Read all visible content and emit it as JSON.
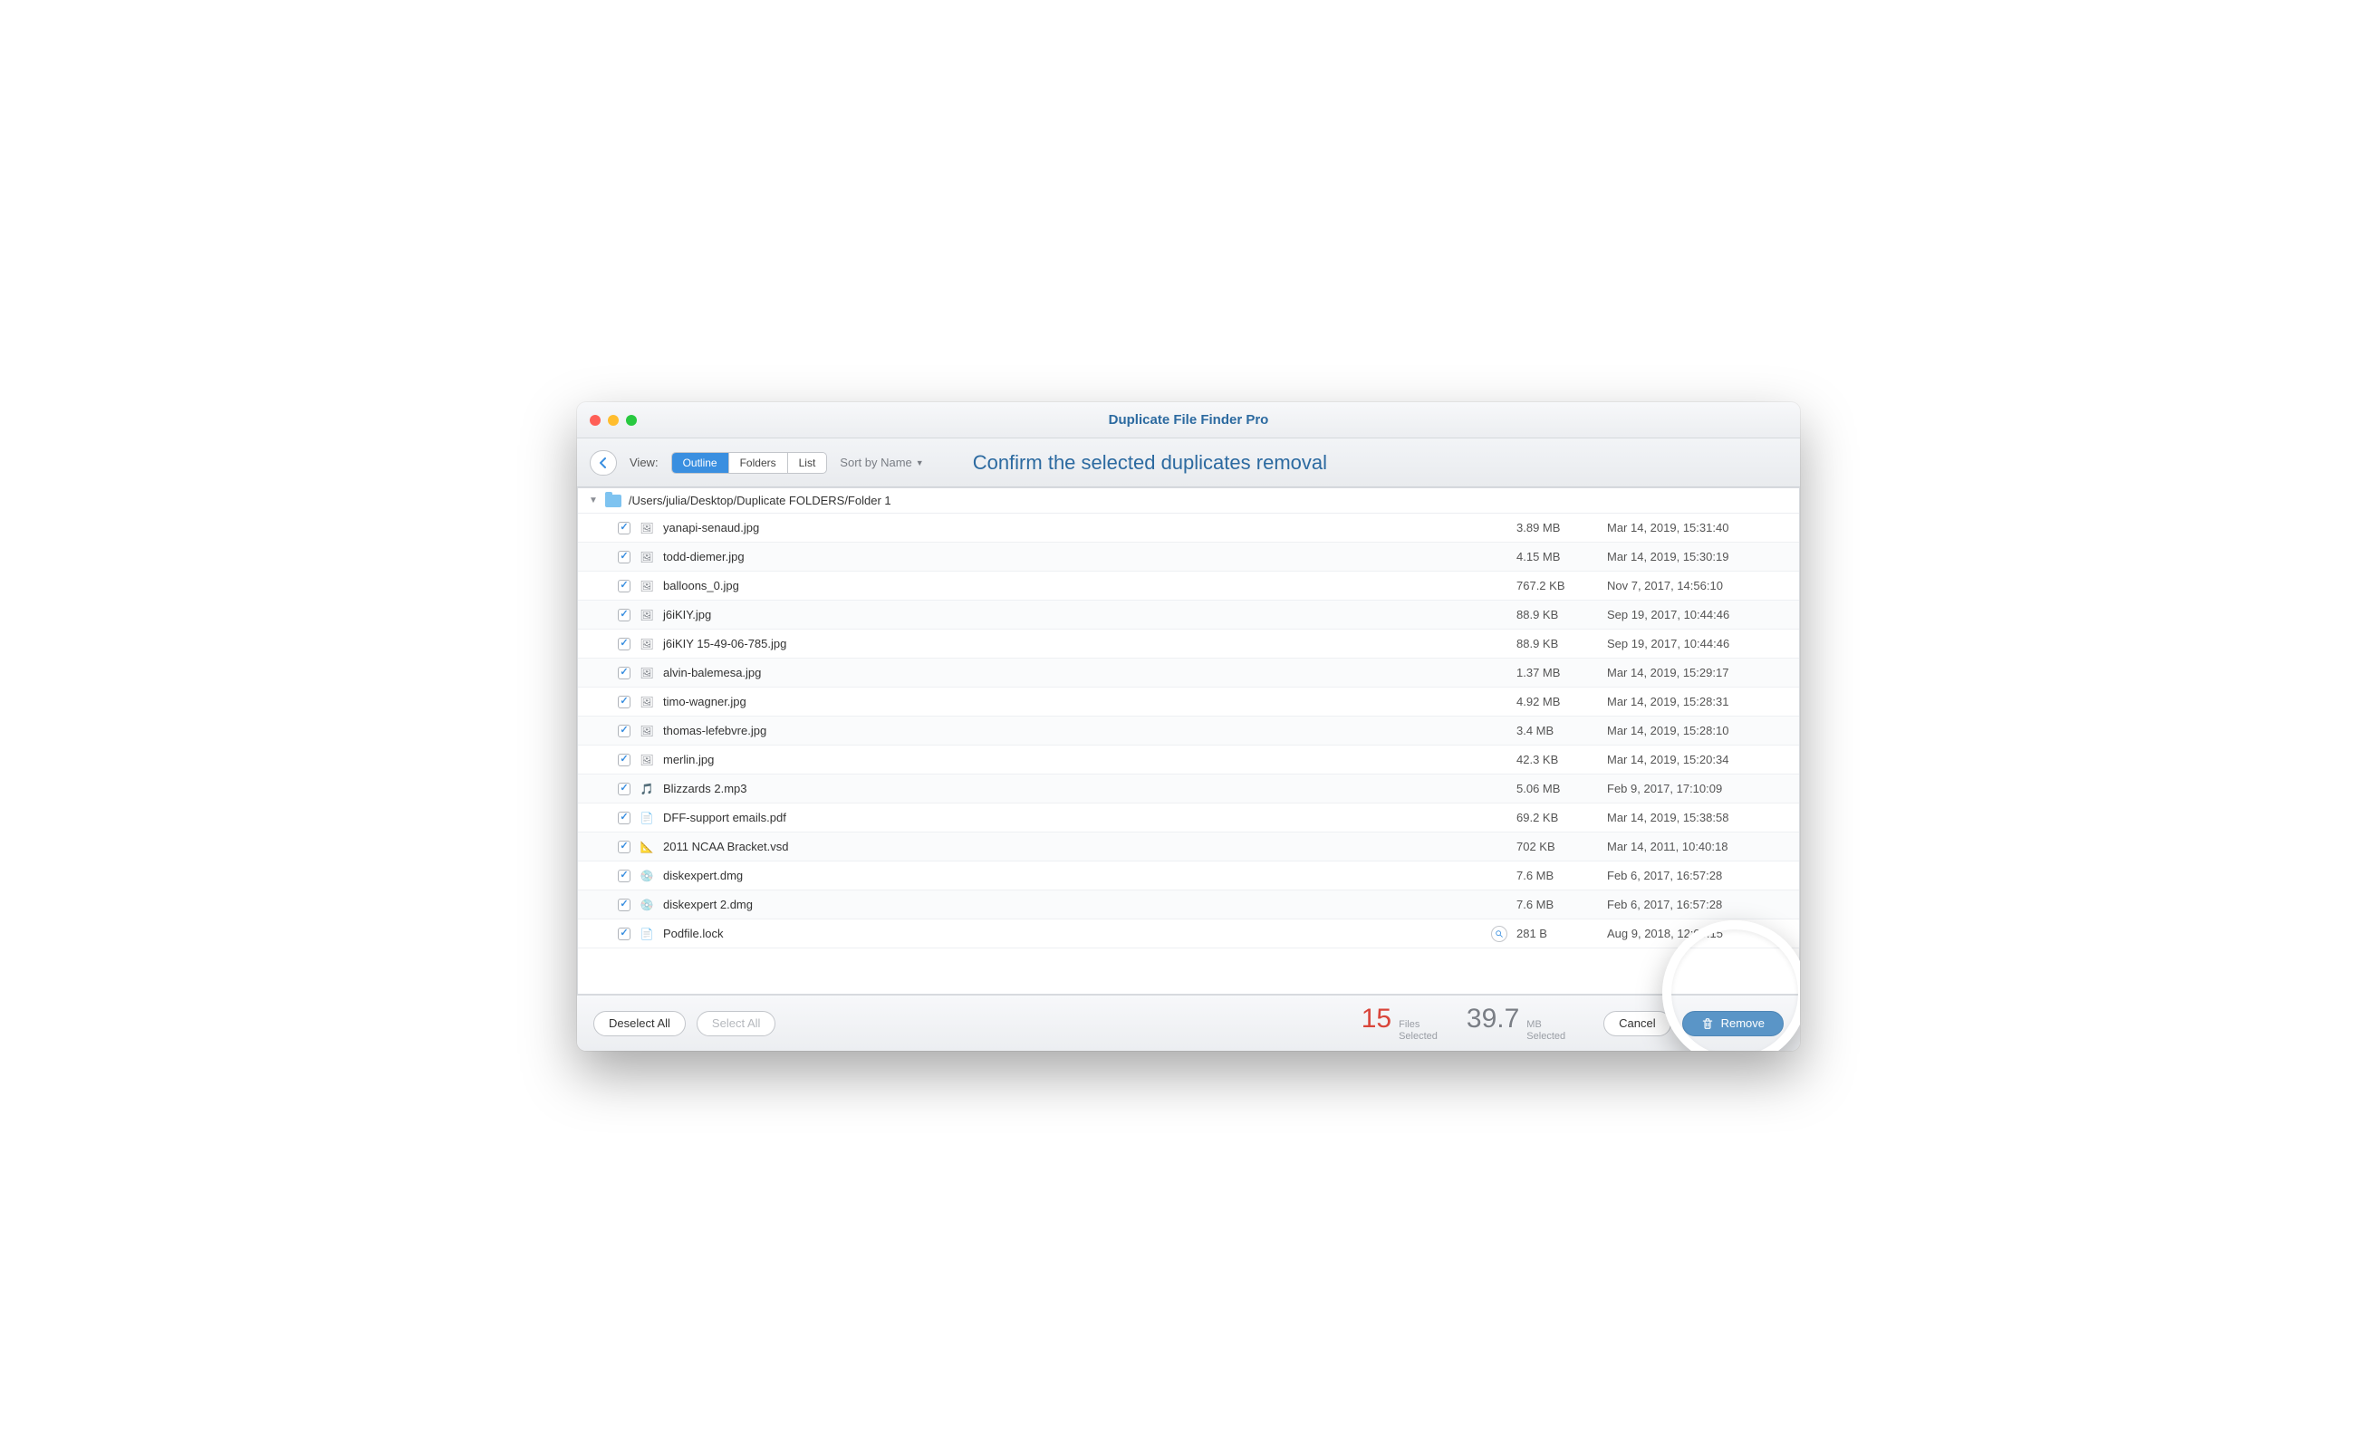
{
  "window": {
    "title": "Duplicate File Finder Pro"
  },
  "toolbar": {
    "view_label": "View:",
    "segments": {
      "outline": "Outline",
      "folders": "Folders",
      "list": "List"
    },
    "active_segment": "outline",
    "sort_label": "Sort by Name",
    "subtitle": "Confirm the selected duplicates removal"
  },
  "group": {
    "path": "/Users/julia/Desktop/Duplicate FOLDERS/Folder 1"
  },
  "files": [
    {
      "name": "yanapi-senaud.jpg",
      "size": "3.89 MB",
      "date": "Mar 14, 2019, 15:31:40",
      "icon": "image",
      "checked": true
    },
    {
      "name": "todd-diemer.jpg",
      "size": "4.15 MB",
      "date": "Mar 14, 2019, 15:30:19",
      "icon": "image",
      "checked": true
    },
    {
      "name": "balloons_0.jpg",
      "size": "767.2 KB",
      "date": "Nov 7, 2017, 14:56:10",
      "icon": "image",
      "checked": true
    },
    {
      "name": "j6iKIY.jpg",
      "size": "88.9 KB",
      "date": "Sep 19, 2017, 10:44:46",
      "icon": "image",
      "checked": true
    },
    {
      "name": "j6iKIY 15-49-06-785.jpg",
      "size": "88.9 KB",
      "date": "Sep 19, 2017, 10:44:46",
      "icon": "image",
      "checked": true
    },
    {
      "name": "alvin-balemesa.jpg",
      "size": "1.37 MB",
      "date": "Mar 14, 2019, 15:29:17",
      "icon": "image",
      "checked": true
    },
    {
      "name": "timo-wagner.jpg",
      "size": "4.92 MB",
      "date": "Mar 14, 2019, 15:28:31",
      "icon": "image",
      "checked": true
    },
    {
      "name": "thomas-lefebvre.jpg",
      "size": "3.4 MB",
      "date": "Mar 14, 2019, 15:28:10",
      "icon": "image",
      "checked": true
    },
    {
      "name": "merlin.jpg",
      "size": "42.3 KB",
      "date": "Mar 14, 2019, 15:20:34",
      "icon": "image",
      "checked": true
    },
    {
      "name": "Blizzards 2.mp3",
      "size": "5.06 MB",
      "date": "Feb 9, 2017, 17:10:09",
      "icon": "audio",
      "checked": true
    },
    {
      "name": "DFF-support emails.pdf",
      "size": "69.2 KB",
      "date": "Mar 14, 2019, 15:38:58",
      "icon": "doc",
      "checked": true
    },
    {
      "name": "2011 NCAA Bracket.vsd",
      "size": "702 KB",
      "date": "Mar 14, 2011, 10:40:18",
      "icon": "vsd",
      "checked": true
    },
    {
      "name": "diskexpert.dmg",
      "size": "7.6 MB",
      "date": "Feb 6, 2017, 16:57:28",
      "icon": "dmg",
      "checked": true
    },
    {
      "name": "diskexpert 2.dmg",
      "size": "7.6 MB",
      "date": "Feb 6, 2017, 16:57:28",
      "icon": "dmg",
      "checked": true
    },
    {
      "name": "Podfile.lock",
      "size": "281 B",
      "date": "Aug 9, 2018, 12:09:15",
      "icon": "blank",
      "checked": true,
      "magnify": true
    }
  ],
  "footer": {
    "deselect": "Deselect All",
    "select": "Select All",
    "files_count": "15",
    "files_label1": "Files",
    "files_label2": "Selected",
    "size_value": "39.7",
    "size_label1": "MB",
    "size_label2": "Selected",
    "cancel": "Cancel",
    "remove": "Remove"
  },
  "colors": {
    "accent": "#3a8fe0",
    "title_blue": "#2c6aa0",
    "red": "#d9453a"
  }
}
